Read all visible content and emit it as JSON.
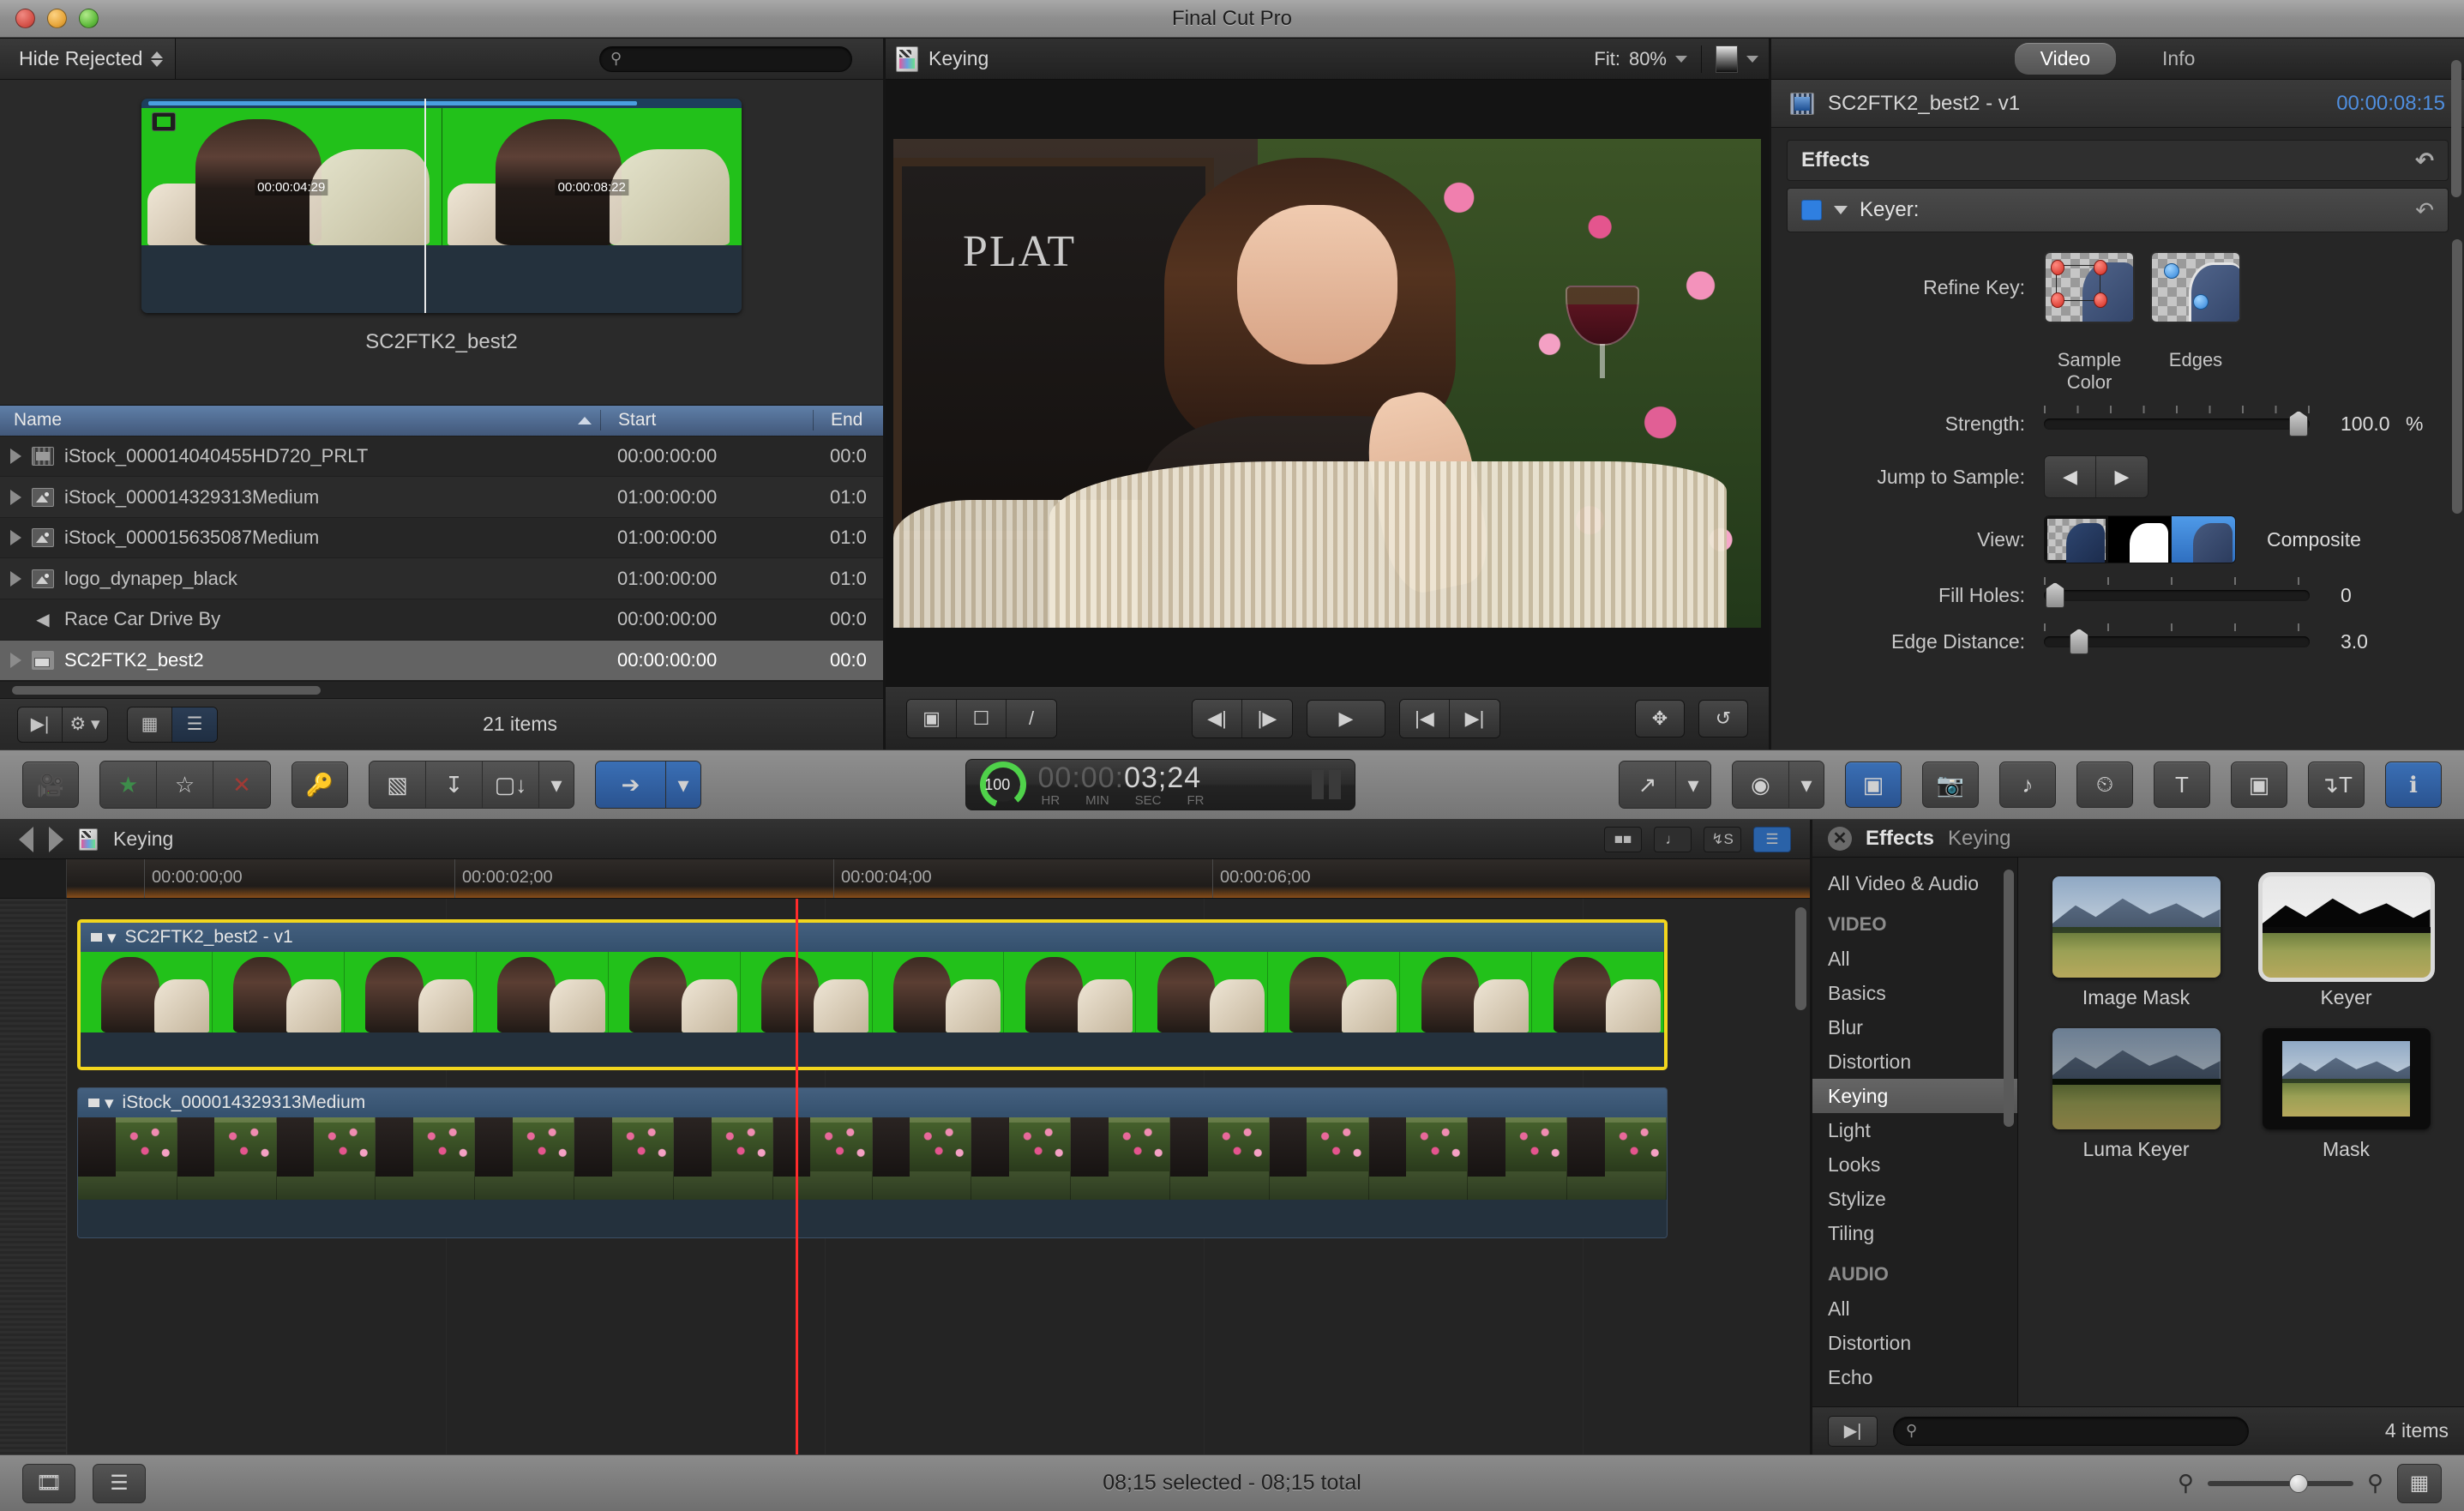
{
  "window": {
    "title": "Final Cut Pro"
  },
  "browser": {
    "filter_label": "Hide Rejected",
    "search_placeholder": "",
    "clip_label": "SC2FTK2_best2",
    "filmstrip_tc_1": "00:00:04:29",
    "filmstrip_tc_2": "00:00:08:22",
    "columns": {
      "name": "Name",
      "start": "Start",
      "end": "End"
    },
    "rows": [
      {
        "name": "iStock_000014040455HD720_PRLT",
        "start": "00:00:00:00",
        "end": "00:0",
        "icon": "film-icon",
        "selected": false,
        "expandable": true
      },
      {
        "name": "iStock_000014329313Medium",
        "start": "01:00:00:00",
        "end": "01:0",
        "icon": "image-icon",
        "selected": false,
        "expandable": true
      },
      {
        "name": "iStock_000015635087Medium",
        "start": "01:00:00:00",
        "end": "01:0",
        "icon": "image-icon",
        "selected": false,
        "expandable": true
      },
      {
        "name": "logo_dynapep_black",
        "start": "01:00:00:00",
        "end": "01:0",
        "icon": "image-icon",
        "selected": false,
        "expandable": true
      },
      {
        "name": "Race Car Drive By",
        "start": "00:00:00:00",
        "end": "00:0",
        "icon": "audio-icon",
        "selected": false,
        "expandable": false
      },
      {
        "name": "SC2FTK2_best2",
        "start": "00:00:00:00",
        "end": "00:0",
        "icon": "project-icon",
        "selected": true,
        "expandable": true
      }
    ],
    "items_count": "21 items"
  },
  "viewer": {
    "title": "Keying",
    "fit_label": "Fit:",
    "zoom_value": "80%",
    "chalk_text": "PLAT",
    "chalk_text2": ""
  },
  "inspector": {
    "tabs": [
      {
        "label": "Video",
        "active": true
      },
      {
        "label": "Info",
        "active": false
      }
    ],
    "clip_name": "SC2FTK2_best2 - v1",
    "clip_duration": "00:00:08:15",
    "effects_header": "Effects",
    "keyer_header": "Keyer:",
    "params": {
      "refine_key_label": "Refine Key:",
      "sample_color_label": "Sample Color",
      "edges_label": "Edges",
      "strength_label": "Strength:",
      "strength_value": "100.0",
      "strength_unit": "%",
      "jump_label": "Jump to Sample:",
      "view_label": "View:",
      "view_mode": "Composite",
      "fill_holes_label": "Fill Holes:",
      "fill_holes_value": "0",
      "edge_distance_label": "Edge Distance:",
      "edge_distance_value": "3.0"
    }
  },
  "toolbar": {
    "timecode": {
      "hours": "00",
      "minutes": "00",
      "seconds": "03",
      "frames": "24",
      "unit_hr": "HR",
      "unit_min": "MIN",
      "unit_sec": "SEC",
      "unit_fr": "FR",
      "percent": "100",
      "percent_symbol": "%"
    }
  },
  "timeline": {
    "project_name": "Keying",
    "ruler_labels": [
      "00:00:00;00",
      "00:00:02;00",
      "00:00:04;00",
      "00:00:06;00"
    ],
    "clips": [
      {
        "name": "SC2FTK2_best2 - v1",
        "selected": true
      },
      {
        "name": "iStock_000014329313Medium",
        "selected": false
      }
    ]
  },
  "effects_browser": {
    "title": "Effects",
    "subtitle": "Keying",
    "categories": [
      {
        "label": "All Video & Audio",
        "type": "item",
        "active": false
      },
      {
        "label": "VIDEO",
        "type": "group",
        "active": false
      },
      {
        "label": "All",
        "type": "item",
        "active": false
      },
      {
        "label": "Basics",
        "type": "item",
        "active": false
      },
      {
        "label": "Blur",
        "type": "item",
        "active": false
      },
      {
        "label": "Distortion",
        "type": "item",
        "active": false
      },
      {
        "label": "Keying",
        "type": "item",
        "active": true
      },
      {
        "label": "Light",
        "type": "item",
        "active": false
      },
      {
        "label": "Looks",
        "type": "item",
        "active": false
      },
      {
        "label": "Stylize",
        "type": "item",
        "active": false
      },
      {
        "label": "Tiling",
        "type": "item",
        "active": false
      },
      {
        "label": "AUDIO",
        "type": "group",
        "active": false
      },
      {
        "label": "All",
        "type": "item",
        "active": false
      },
      {
        "label": "Distortion",
        "type": "item",
        "active": false
      },
      {
        "label": "Echo",
        "type": "item",
        "active": false
      }
    ],
    "items": [
      {
        "label": "Image Mask",
        "selected": false,
        "style": "plain"
      },
      {
        "label": "Keyer",
        "selected": true,
        "style": "keyed"
      },
      {
        "label": "Luma Keyer",
        "selected": false,
        "style": "luma"
      },
      {
        "label": "Mask",
        "selected": false,
        "style": "mask"
      }
    ],
    "search_placeholder": "",
    "count": "4 items"
  },
  "statusbar": {
    "status": "08;15 selected - 08;15 total"
  }
}
